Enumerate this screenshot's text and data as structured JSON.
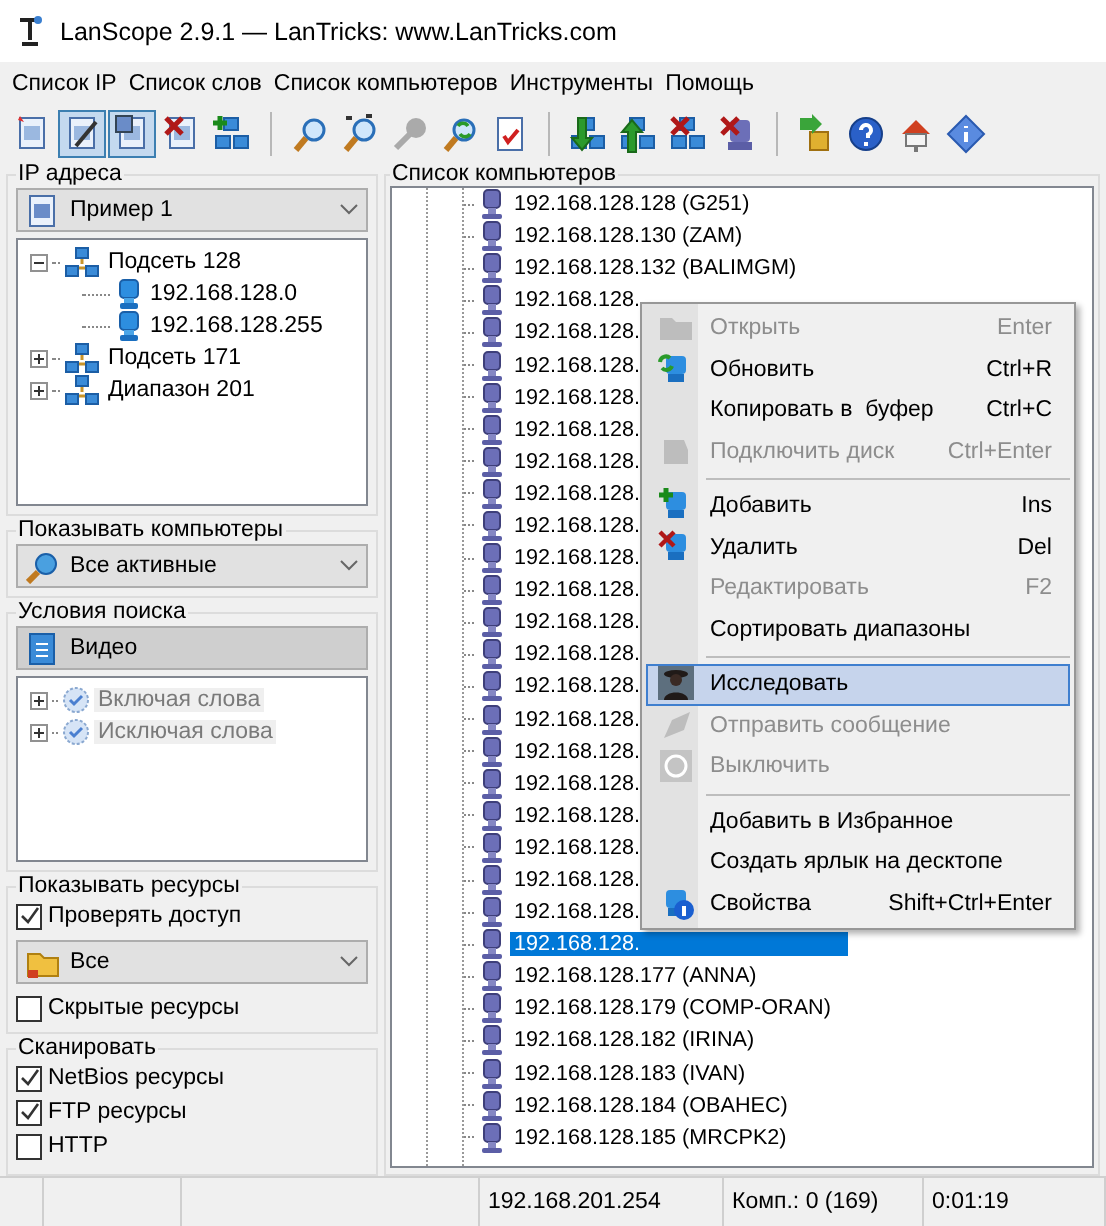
{
  "window": {
    "title": "LanScope 2.9.1 — LanTricks: www.LanTricks.com"
  },
  "menu": [
    "Список IP",
    "Список слов",
    "Список компьютеров",
    "Инструменты",
    "Помощь"
  ],
  "toolbar": [
    {
      "buttons": [
        {
          "pressed": false
        },
        {
          "pressed": true
        },
        {
          "pressed": true
        },
        {
          "pressed": false
        },
        {
          "pressed": false
        }
      ]
    },
    {
      "buttons": [
        {
          "pressed": false
        },
        {
          "pressed": false
        },
        {
          "pressed": false
        },
        {
          "pressed": false
        },
        {
          "pressed": false
        }
      ]
    },
    {
      "buttons": [
        {
          "pressed": false
        },
        {
          "pressed": false
        },
        {
          "pressed": false
        },
        {
          "pressed": false
        }
      ]
    },
    {
      "buttons": [
        {
          "pressed": false
        },
        {
          "pressed": false
        },
        {
          "pressed": false
        },
        {
          "pressed": false
        }
      ]
    }
  ],
  "ip_addresses": {
    "title": "IP адреса",
    "combo": "Пример 1",
    "tree": [
      {
        "label": "Подсеть 128",
        "expanded": true,
        "children": [
          {
            "label": "192.168.128.0"
          },
          {
            "label": "192.168.128.255"
          }
        ]
      },
      {
        "label": "Подсеть 171",
        "expanded": false
      },
      {
        "label": "Диапазон 201",
        "expanded": false
      }
    ]
  },
  "show_computers": {
    "title": "Показывать компьютеры",
    "combo": "Все активные"
  },
  "search_conditions": {
    "title": "Условия поиска",
    "disabled": true,
    "combo": "Видео",
    "tree": [
      {
        "label": "Включая слова",
        "expanded": false
      },
      {
        "label": "Исключая слова",
        "expanded": false
      }
    ]
  },
  "show_resources": {
    "title": "Показывать ресурсы",
    "items": [
      {
        "kind": "checkbox",
        "label": "Проверять доступ",
        "checked": true
      },
      {
        "kind": "combo",
        "value": "Все"
      },
      {
        "kind": "checkbox",
        "label": "Скрытые ресурсы",
        "checked": false
      }
    ]
  },
  "scan": {
    "title": "Сканировать",
    "options": [
      {
        "label": "NetBios ресурсы",
        "checked": true
      },
      {
        "label": "FTP ресурсы",
        "checked": true
      },
      {
        "label": "HTTP",
        "checked": false
      }
    ]
  },
  "computers": {
    "title": "Список компьютеров",
    "rows": [
      {
        "label": "192.168.128.128 (G251)",
        "selected": false
      },
      {
        "label": "192.168.128.130 (ZAM)",
        "selected": false
      },
      {
        "label": "192.168.128.132 (BALIMGM)",
        "selected": false
      },
      {
        "label": "192.168.128.",
        "selected": false
      },
      {
        "label": "192.168.128.",
        "selected": false
      },
      {
        "label": "192.168.128.",
        "selected": false
      },
      {
        "label": "192.168.128.",
        "selected": false
      },
      {
        "label": "192.168.128.",
        "selected": false
      },
      {
        "label": "192.168.128.",
        "selected": false
      },
      {
        "label": "192.168.128.",
        "selected": false
      },
      {
        "label": "192.168.128.",
        "selected": false
      },
      {
        "label": "192.168.128.",
        "selected": false
      },
      {
        "label": "192.168.128.",
        "selected": false
      },
      {
        "label": "192.168.128.",
        "selected": false
      },
      {
        "label": "192.168.128.",
        "selected": false
      },
      {
        "label": "192.168.128.",
        "selected": false
      },
      {
        "label": "192.168.128.",
        "selected": false
      },
      {
        "label": "192.168.128.",
        "selected": false
      },
      {
        "label": "192.168.128.",
        "selected": false
      },
      {
        "label": "192.168.128.",
        "selected": false
      },
      {
        "label": "192.168.128.",
        "selected": false
      },
      {
        "label": "192.168.128.",
        "selected": false
      },
      {
        "label": "192.168.128.",
        "selected": false
      },
      {
        "label": "192.168.128.",
        "selected": true
      },
      {
        "label": "192.168.128.177 (ANNA)",
        "selected": false
      },
      {
        "label": "192.168.128.179 (COMP-ORAN)",
        "selected": false
      },
      {
        "label": "192.168.128.182 (IRINA)",
        "selected": false
      },
      {
        "label": "192.168.128.183 (IVAN)",
        "selected": false
      },
      {
        "label": "192.168.128.184 (OBAHEC)",
        "selected": false
      },
      {
        "label": "192.168.128.185 (MRCPK2)",
        "selected": false
      }
    ]
  },
  "context_menu": [
    {
      "kind": "item",
      "label": "Открыть",
      "shortcut": "Enter",
      "disabled": true,
      "highlighted": false
    },
    {
      "kind": "item",
      "label": "Обновить",
      "shortcut": "Ctrl+R",
      "disabled": false,
      "highlighted": false
    },
    {
      "kind": "item",
      "label": "Копировать в  буфер",
      "shortcut": "Ctrl+C",
      "disabled": false,
      "highlighted": false
    },
    {
      "kind": "item",
      "label": "Подключить диск",
      "shortcut": "Ctrl+Enter",
      "disabled": true,
      "highlighted": false
    },
    {
      "kind": "separator"
    },
    {
      "kind": "item",
      "label": "Добавить",
      "shortcut": "Ins",
      "disabled": false,
      "highlighted": false
    },
    {
      "kind": "item",
      "label": "Удалить",
      "shortcut": "Del",
      "disabled": false,
      "highlighted": false
    },
    {
      "kind": "item",
      "label": "Редактировать",
      "shortcut": "F2",
      "disabled": true,
      "highlighted": false
    },
    {
      "kind": "item",
      "label": "Сортировать диапазоны",
      "disabled": false,
      "highlighted": false
    },
    {
      "kind": "separator"
    },
    {
      "kind": "item",
      "label": "Исследовать",
      "disabled": false,
      "highlighted": true
    },
    {
      "kind": "item",
      "label": "Отправить сообщение",
      "disabled": true,
      "highlighted": false
    },
    {
      "kind": "item",
      "label": "Выключить",
      "disabled": true,
      "highlighted": false
    },
    {
      "kind": "separator"
    },
    {
      "kind": "item",
      "label": "Добавить в Избранное",
      "disabled": false,
      "highlighted": false
    },
    {
      "kind": "item",
      "label": "Создать ярлык на десктопе",
      "disabled": false,
      "highlighted": false
    },
    {
      "kind": "item",
      "label": "Свойства",
      "shortcut": "Shift+Ctrl+Enter",
      "disabled": false,
      "highlighted": false
    }
  ],
  "status_bar": [
    "192.168.201.254",
    "Комп.: 0 (169)",
    "0:01:19"
  ]
}
